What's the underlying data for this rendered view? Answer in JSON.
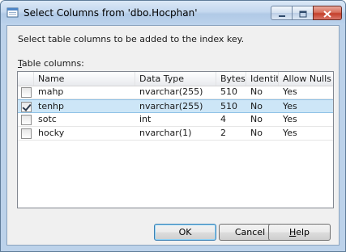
{
  "window": {
    "title": "Select Columns from 'dbo.Hocphan'"
  },
  "dialog": {
    "instruction": "Select table columns to be added to the index key.",
    "grid_label": "Table columns:",
    "grid_label_access_key": "T",
    "grid_label_rest": "able columns:"
  },
  "table": {
    "headers": {
      "name": "Name",
      "data_type": "Data Type",
      "bytes": "Bytes",
      "identity": "Identity",
      "allow_nulls": "Allow Nulls"
    },
    "rows": [
      {
        "checked": false,
        "selected": false,
        "name": "mahp",
        "data_type": "nvarchar(255)",
        "bytes": "510",
        "identity": "No",
        "allow_nulls": "Yes"
      },
      {
        "checked": true,
        "selected": true,
        "name": "tenhp",
        "data_type": "nvarchar(255)",
        "bytes": "510",
        "identity": "No",
        "allow_nulls": "Yes"
      },
      {
        "checked": false,
        "selected": false,
        "name": "sotc",
        "data_type": "int",
        "bytes": "4",
        "identity": "No",
        "allow_nulls": "Yes"
      },
      {
        "checked": false,
        "selected": false,
        "name": "hocky",
        "data_type": "nvarchar(1)",
        "bytes": "2",
        "identity": "No",
        "allow_nulls": "Yes"
      }
    ]
  },
  "buttons": {
    "ok": "OK",
    "cancel": "Cancel",
    "help": "Help",
    "help_access_key": "H",
    "help_rest": "elp"
  },
  "colors": {
    "selection": "#cde6f7",
    "title_gradient_top": "#dbe8f6",
    "close_button": "#c4402b"
  },
  "icons": {
    "app": "dialog-icon",
    "minimize": "minimize-icon",
    "maximize": "maximize-icon",
    "close": "close-icon"
  }
}
